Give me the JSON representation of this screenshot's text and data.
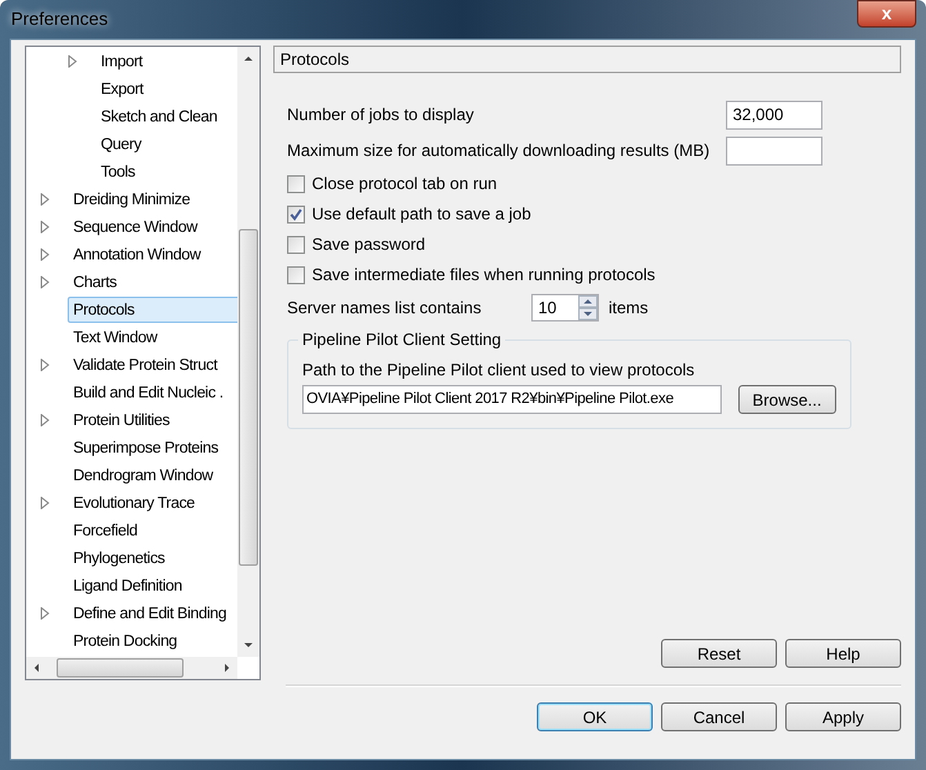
{
  "window": {
    "title": "Preferences",
    "close": "x"
  },
  "tree": {
    "continued_children": [
      {
        "label": "Import",
        "expandable": true,
        "selected": false
      },
      {
        "label": "Export",
        "expandable": false,
        "selected": false
      },
      {
        "label": "Sketch and Clean",
        "expandable": false,
        "selected": false
      },
      {
        "label": "Query",
        "expandable": false,
        "selected": false
      },
      {
        "label": "Tools",
        "expandable": false,
        "selected": false
      }
    ],
    "items": [
      {
        "label": "Dreiding Minimize",
        "expandable": true,
        "selected": false
      },
      {
        "label": "Sequence Window",
        "expandable": true,
        "selected": false
      },
      {
        "label": "Annotation Window",
        "expandable": true,
        "selected": false
      },
      {
        "label": "Charts",
        "expandable": true,
        "selected": false
      },
      {
        "label": "Protocols",
        "expandable": false,
        "selected": true
      },
      {
        "label": "Text Window",
        "expandable": false,
        "selected": false
      },
      {
        "label": "Validate Protein Struct",
        "expandable": true,
        "selected": false
      },
      {
        "label": "Build and Edit Nucleic .",
        "expandable": false,
        "selected": false
      },
      {
        "label": "Protein Utilities",
        "expandable": true,
        "selected": false
      },
      {
        "label": "Superimpose Proteins",
        "expandable": false,
        "selected": false
      },
      {
        "label": "Dendrogram Window",
        "expandable": false,
        "selected": false
      },
      {
        "label": "Evolutionary Trace",
        "expandable": true,
        "selected": false
      },
      {
        "label": "Forcefield",
        "expandable": false,
        "selected": false
      },
      {
        "label": "Phylogenetics",
        "expandable": false,
        "selected": false
      },
      {
        "label": "Ligand Definition",
        "expandable": false,
        "selected": false
      },
      {
        "label": "Define and Edit Binding",
        "expandable": true,
        "selected": false
      },
      {
        "label": "Protein Docking",
        "expandable": false,
        "selected": false
      }
    ]
  },
  "panel": {
    "title": "Protocols",
    "settings": [
      {
        "kind": "field",
        "label": "Number of jobs to display",
        "value": "32,000"
      },
      {
        "kind": "field",
        "label": "Maximum size for automatically downloading results (MB)"
      },
      {
        "kind": "checkbox",
        "label": "Close protocol tab on run",
        "checked": false
      },
      {
        "kind": "checkbox",
        "label": "Use default path to save a job",
        "checked": true
      },
      {
        "kind": "checkbox",
        "label": "Save password",
        "checked": false
      },
      {
        "kind": "checkbox",
        "label": "Save intermediate files when running protocols",
        "checked": false
      },
      {
        "kind": "spinner",
        "label": "Server names list contains",
        "value": "10",
        "unit": "items"
      }
    ],
    "group": {
      "title": "Pipeline Pilot Client Setting",
      "label": "Path to the Pipeline Pilot client used to view protocols",
      "path": "OVIA¥Pipeline Pilot Client 2017 R2¥bin¥Pipeline Pilot.exe",
      "browse": "Browse..."
    },
    "buttons": [
      "Reset",
      "Help"
    ]
  },
  "buttons": [
    {
      "label": "OK",
      "default": true
    },
    {
      "label": "Cancel",
      "default": false
    },
    {
      "label": "Apply",
      "default": false
    }
  ]
}
